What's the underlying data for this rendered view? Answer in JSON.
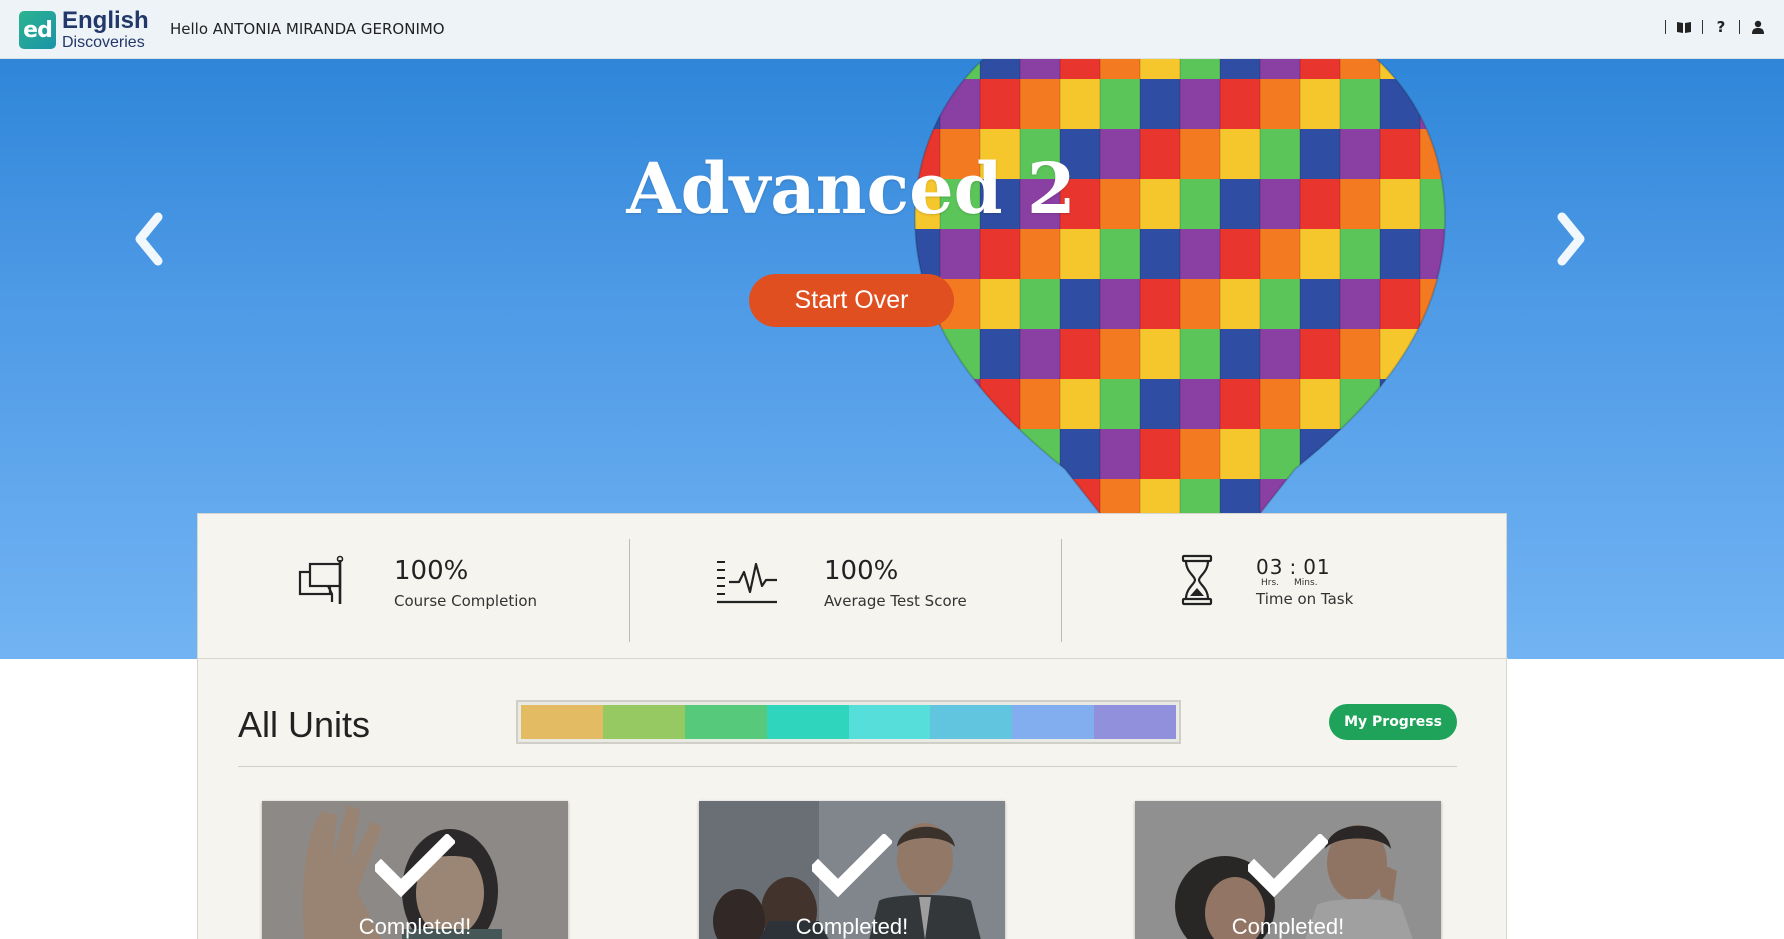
{
  "header": {
    "logo_mark": "ed",
    "logo_line1": "English",
    "logo_line2": "Discoveries",
    "greeting": "Hello ANTONIA MIRANDA GERONIMO",
    "icons": [
      "book-icon",
      "help-icon",
      "user-icon"
    ],
    "help_glyph": "?"
  },
  "hero": {
    "title": "Advanced 2",
    "start_button": "Start Over",
    "prev_icon": "chevron-left-icon",
    "next_icon": "chevron-right-icon"
  },
  "stats": {
    "completion": {
      "value": "100%",
      "label": "Course Completion",
      "icon": "flag-icon"
    },
    "test_score": {
      "value": "100%",
      "label": "Average Test Score",
      "icon": "pulse-chart-icon"
    },
    "time": {
      "hours": "03",
      "separator": ":",
      "minutes": "01",
      "hours_label": "Hrs.",
      "minutes_label": "Mins.",
      "label": "Time on Task",
      "icon": "hourglass-icon"
    }
  },
  "units": {
    "title": "All Units",
    "progress_button": "My Progress",
    "segment_colors": [
      "#e2bb62",
      "#97c963",
      "#57c97b",
      "#2fd6bd",
      "#56dedb",
      "#62c5df",
      "#82adee",
      "#9190dc"
    ],
    "cards": [
      {
        "label": "Completed!",
        "icon": "checkmark-icon"
      },
      {
        "label": "Completed!",
        "icon": "checkmark-icon"
      },
      {
        "label": "Completed!",
        "icon": "checkmark-icon"
      }
    ]
  },
  "colors": {
    "accent_orange": "#e04f1f",
    "accent_green": "#1fa35a",
    "brand_navy": "#23386a"
  }
}
